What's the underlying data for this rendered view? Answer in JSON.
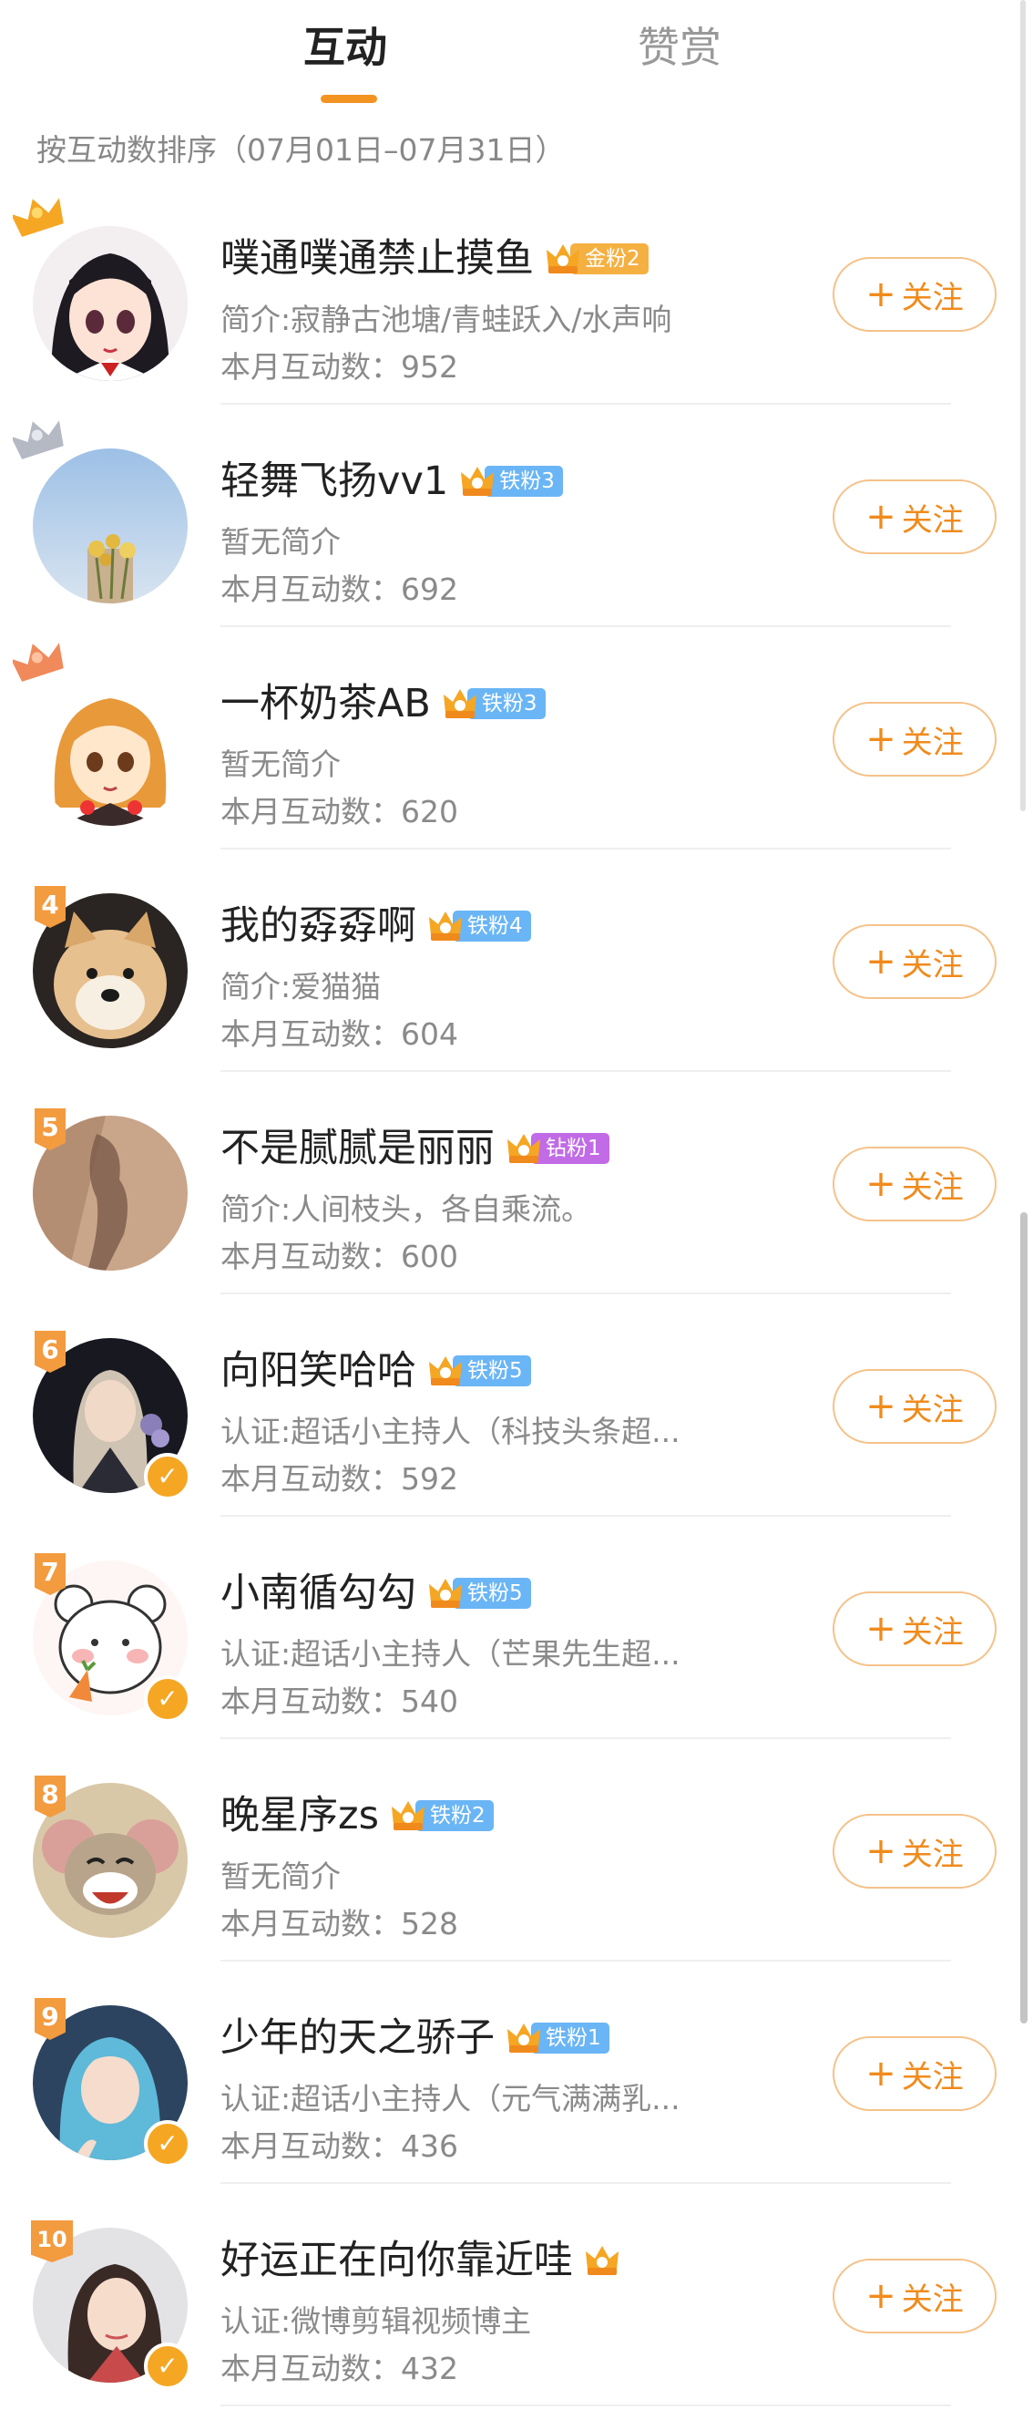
{
  "tabs": {
    "interaction": "互动",
    "reward": "赞赏"
  },
  "sort_label": "按互动数排序（07月01日–07月31日）",
  "follow_label": "关注",
  "follow_plus": "+",
  "colors": {
    "accent": "#f39422",
    "gold_badge": "#f5b042",
    "iron_badge": "#6ab5f5",
    "diamond_badge": "#c16be6"
  },
  "users": [
    {
      "rank": "1",
      "name": "噗通噗通禁止摸鱼",
      "badge": "金粉2",
      "badge_type": "gold",
      "intro": "简介:寂静古池塘/青蛙跃入/水声响",
      "count": "本月互动数：952",
      "verified": false
    },
    {
      "rank": "2",
      "name": "轻舞飞扬vv1",
      "badge": "铁粉3",
      "badge_type": "iron",
      "intro": "暂无简介",
      "count": "本月互动数：692",
      "verified": false
    },
    {
      "rank": "3",
      "name": "一杯奶茶AB",
      "badge": "铁粉3",
      "badge_type": "iron",
      "intro": "暂无简介",
      "count": "本月互动数：620",
      "verified": false
    },
    {
      "rank": "4",
      "name": "我的孬孬啊",
      "badge": "铁粉4",
      "badge_type": "iron",
      "intro": "简介:爱猫猫",
      "count": "本月互动数：604",
      "verified": false
    },
    {
      "rank": "5",
      "name": "不是腻腻是丽丽",
      "badge": "钻粉1",
      "badge_type": "diamond",
      "intro": "简介:人间枝头，各自乘流。",
      "count": "本月互动数：600",
      "verified": false
    },
    {
      "rank": "6",
      "name": "向阳笑哈哈",
      "badge": "铁粉5",
      "badge_type": "iron",
      "intro": "认证:超话小主持人（科技头条超...",
      "count": "本月互动数：592",
      "verified": true
    },
    {
      "rank": "7",
      "name": "小南循勾勾",
      "badge": "铁粉5",
      "badge_type": "iron",
      "intro": "认证:超话小主持人（芒果先生超...",
      "count": "本月互动数：540",
      "verified": true
    },
    {
      "rank": "8",
      "name": "晚星序zs",
      "badge": "铁粉2",
      "badge_type": "iron",
      "intro": "暂无简介",
      "count": "本月互动数：528",
      "verified": false
    },
    {
      "rank": "9",
      "name": "少年的天之骄子",
      "badge": "铁粉1",
      "badge_type": "iron",
      "intro": "认证:超话小主持人（元气满满乳...",
      "count": "本月互动数：436",
      "verified": true
    },
    {
      "rank": "10",
      "name": "好运正在向你靠近哇",
      "badge": "",
      "badge_type": "crown-only",
      "intro": "认证:微博剪辑视频博主",
      "count": "本月互动数：432",
      "verified": true
    }
  ]
}
